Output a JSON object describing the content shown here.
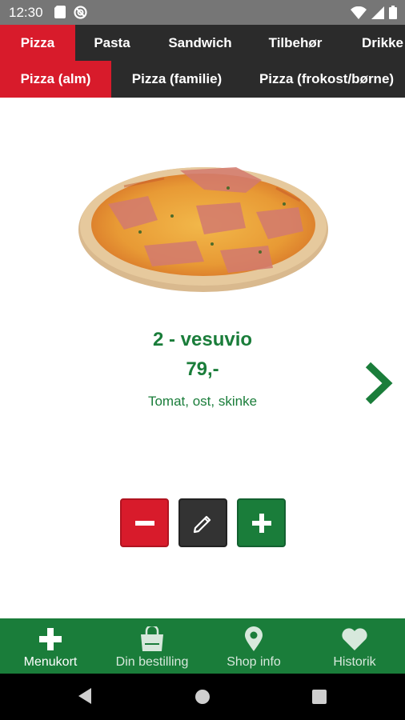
{
  "status_bar": {
    "time": "12:30"
  },
  "categories": [
    {
      "label": "Pizza",
      "active": true
    },
    {
      "label": "Pasta",
      "active": false
    },
    {
      "label": "Sandwich",
      "active": false
    },
    {
      "label": "Tilbehør",
      "active": false
    },
    {
      "label": "Drikke",
      "active": false
    }
  ],
  "subcategories": [
    {
      "label": "Pizza (alm)",
      "active": true
    },
    {
      "label": "Pizza (familie)",
      "active": false
    },
    {
      "label": "Pizza (frokost/børne)",
      "active": false
    }
  ],
  "product": {
    "title": "2 - vesuvio",
    "price": "79,-",
    "description": "Tomat, ost, skinke"
  },
  "bottom_nav": [
    {
      "label": "Menukort",
      "icon": "plus-icon",
      "active": true
    },
    {
      "label": "Din bestilling",
      "icon": "shopping-bag-icon",
      "active": false
    },
    {
      "label": "Shop info",
      "icon": "location-pin-icon",
      "active": false
    },
    {
      "label": "Historik",
      "icon": "heart-icon",
      "active": false
    }
  ],
  "colors": {
    "accent_red": "#d81b2b",
    "accent_green": "#1a7d3a",
    "dark": "#2b2b2b"
  }
}
